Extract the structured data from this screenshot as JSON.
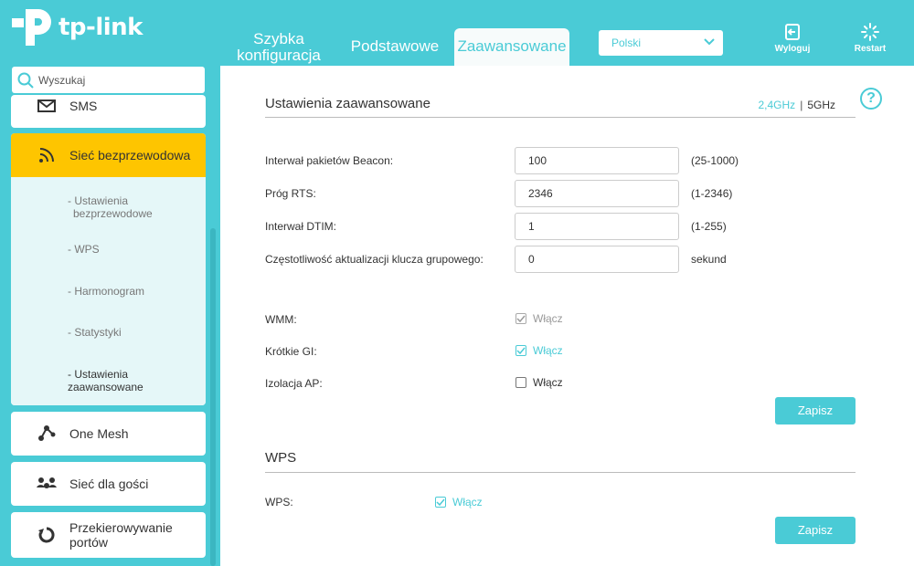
{
  "brand": {
    "name": "tp-link"
  },
  "nav": {
    "tabs": [
      {
        "label_line1": "Szybka",
        "label_line2": "konfiguracja"
      },
      {
        "label": "Podstawowe"
      },
      {
        "label": "Zaawansowane"
      }
    ],
    "language": "Polski",
    "logout_label": "Wyloguj",
    "restart_label": "Restart"
  },
  "sidebar": {
    "search_placeholder": "Wyszukaj",
    "items": [
      {
        "label": "SMS",
        "icon": "envelope-icon"
      },
      {
        "label": "Sieć bezprzewodowa",
        "icon": "wifi-icon"
      },
      {
        "label": "One Mesh",
        "icon": "mesh-icon"
      },
      {
        "label": "Sieć dla gości",
        "icon": "guests-icon"
      },
      {
        "label_line1": "Przekierowywanie",
        "label_line2": "portów",
        "icon": "port-forward-icon"
      }
    ],
    "subitems": [
      {
        "label_line1": "- Ustawienia",
        "label_line2": "bezprzewodowe"
      },
      {
        "label": "- WPS"
      },
      {
        "label": "- Harmonogram"
      },
      {
        "label": "- Statystyki"
      },
      {
        "label": "- Ustawienia zaawansowane"
      }
    ]
  },
  "advanced": {
    "title": "Ustawienia zaawansowane",
    "band_24": "2,4GHz",
    "band_sep": "|",
    "band_5": "5GHz",
    "fields": [
      {
        "label": "Interwał pakietów Beacon:",
        "value": "100",
        "hint": "(25-1000)"
      },
      {
        "label": "Próg RTS:",
        "value": "2346",
        "hint": "(1-2346)"
      },
      {
        "label": "Interwał DTIM:",
        "value": "1",
        "hint": "(1-255)"
      },
      {
        "label": "Częstotliwość aktualizacji klucza grupowego:",
        "value": "0",
        "hint": "sekund"
      }
    ],
    "checkboxes": [
      {
        "label": "WMM:",
        "text": "Włącz",
        "checked": true,
        "disabled": true
      },
      {
        "label": "Krótkie GI:",
        "text": "Włącz",
        "checked": true,
        "disabled": false
      },
      {
        "label": "Izolacja AP:",
        "text": "Włącz",
        "checked": false,
        "disabled": false
      }
    ],
    "save_label": "Zapisz"
  },
  "wps": {
    "title": "WPS",
    "label": "WPS:",
    "text": "Włącz",
    "checked": true,
    "save_label": "Zapisz"
  },
  "colors": {
    "accent": "#4acbd6",
    "active_item": "#fec500",
    "submenu_bg": "#e5f7f8"
  }
}
